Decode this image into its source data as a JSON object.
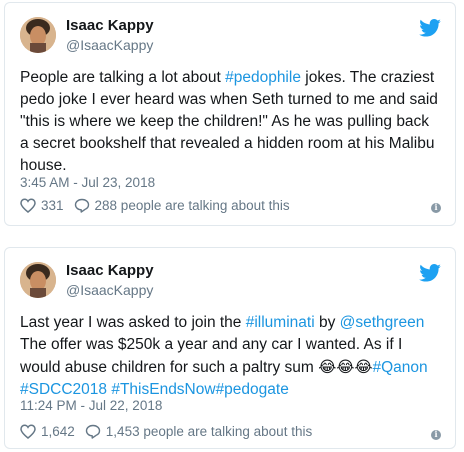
{
  "tweets": [
    {
      "name": "Isaac Kappy",
      "handle": "@IsaacKappy",
      "text_segments": [
        {
          "t": "People are talking a lot about ",
          "link": false
        },
        {
          "t": "#pedophile",
          "link": true
        },
        {
          "t": " jokes. The craziest pedo joke I ever heard was when Seth turned to me and said \"this is where we keep the children!\" As he was pulling back a secret bookshelf that revealed a hidden room at his Malibu house.",
          "link": false
        }
      ],
      "time": "3:45 AM - Jul 23, 2018",
      "likes": "331",
      "talking": "288 people are talking about this"
    },
    {
      "name": "Isaac Kappy",
      "handle": "@IsaacKappy",
      "text_segments": [
        {
          "t": "Last year I was asked to join the ",
          "link": false
        },
        {
          "t": "#illuminati",
          "link": true
        },
        {
          "t": " by ",
          "link": false
        },
        {
          "t": "@sethgreen",
          "link": true
        },
        {
          "t": " The offer was $250k a year and any car I wanted. As if I would abuse children for such a paltry sum ",
          "link": false
        },
        {
          "t": "😂😂😂",
          "link": false,
          "emoji": true
        },
        {
          "t": "#Qanon #SDCC2018 #ThisEndsNow#pedogate",
          "link": true
        }
      ],
      "time": "11:24 PM - Jul 22, 2018",
      "likes": "1,642",
      "talking": "1,453 people are talking about this"
    }
  ],
  "colors": {
    "link": "#1b95e0",
    "meta": "#657786",
    "twitter_blue": "#1da1f2"
  },
  "icons": [
    "twitter-bird-icon",
    "heart-icon",
    "reply-icon",
    "info-icon"
  ]
}
